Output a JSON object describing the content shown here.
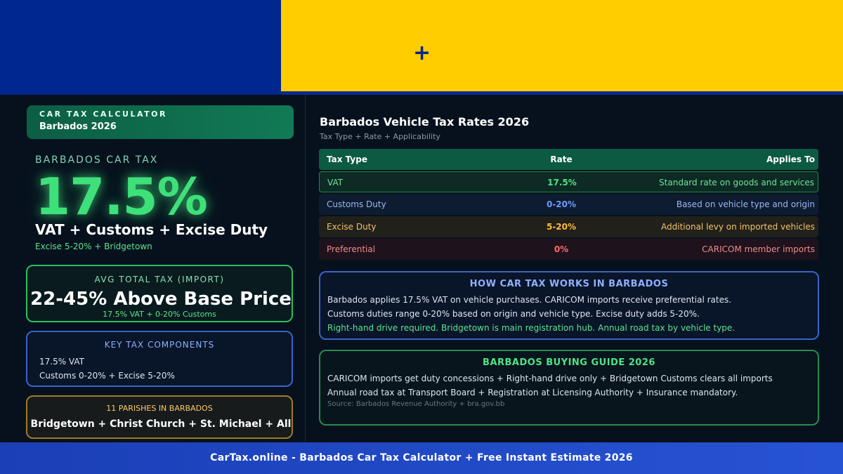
{
  "banner": {
    "colors": {
      "blue": "#00278d",
      "gold": "#ffcd00"
    },
    "symbol": "+"
  },
  "left": {
    "badge": {
      "title": "CAR TAX CALCULATOR",
      "subtitle": "Barbados 2026"
    },
    "car_tax_label": "BARBADOS CAR TAX",
    "headline_rate": "17.5%",
    "headline_sub": "VAT + Customs + Excise Duty",
    "headline_small": "Excise 5-20% + Bridgetown",
    "avg": {
      "label": "AVG TOTAL TAX (IMPORT)",
      "value": "22-45% Above Base Price",
      "small": "17.5% VAT + 0-20% Customs"
    },
    "components": {
      "label": "KEY TAX COMPONENTS",
      "line1": "17.5% VAT",
      "line2": "Customs 0-20% + Excise 5-20%"
    },
    "parishes": {
      "label": "11 PARISHES IN BARBADOS",
      "value": "Bridgetown + Christ Church + St. Michael + All"
    }
  },
  "right": {
    "title": "Barbados Vehicle Tax Rates 2026",
    "subtitle": "Tax Type + Rate + Applicability",
    "table": {
      "headers": [
        "Tax Type",
        "Rate",
        "Applies To"
      ],
      "rows": [
        [
          "VAT",
          "17.5%",
          "Standard rate on goods and services"
        ],
        [
          "Customs Duty",
          "0-20%",
          "Based on vehicle type and origin"
        ],
        [
          "Excise Duty",
          "5-20%",
          "Additional levy on imported vehicles"
        ],
        [
          "Preferential",
          "0%",
          "CARICOM member imports"
        ]
      ]
    },
    "how": {
      "label": "HOW CAR TAX WORKS IN BARBADOS",
      "line1": "Barbados applies 17.5% VAT on vehicle purchases. CARICOM imports receive preferential rates.",
      "line2": "Customs duties range 0-20% based on origin and vehicle type. Excise duty adds 5-20%.",
      "line3": "Right-hand drive required. Bridgetown is main registration hub. Annual road tax by vehicle type."
    },
    "guide": {
      "label": "BARBADOS BUYING GUIDE 2026",
      "line1": "CARICOM imports get duty concessions + Right-hand drive only + Bridgetown Customs clears all imports",
      "line2": "Annual road tax at Transport Board + Registration at Licensing Authority + Insurance mandatory.",
      "source": "Source: Barbados Revenue Authority + bra.gov.bb"
    }
  },
  "footer": {
    "text": "CarTax.online - Barbados Car Tax Calculator + Free Instant Estimate 2026"
  }
}
